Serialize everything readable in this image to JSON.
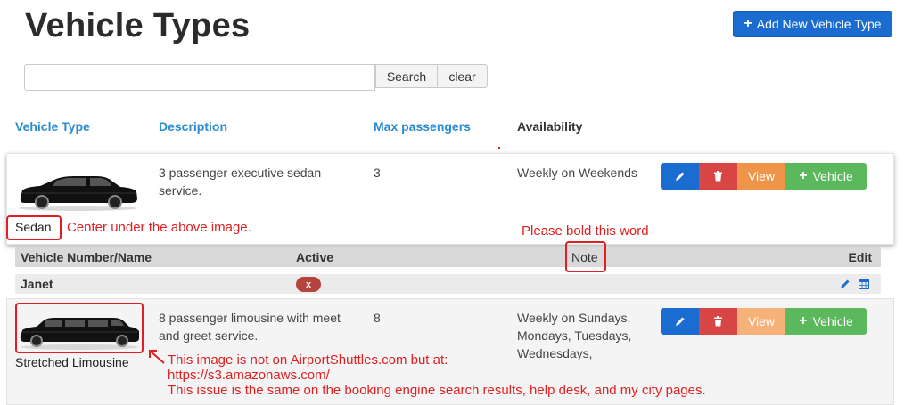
{
  "header": {
    "title": "Vehicle Types",
    "add_button_label": "Add New Vehicle Type"
  },
  "search": {
    "value": "",
    "placeholder": "",
    "search_label": "Search",
    "clear_label": "clear"
  },
  "table": {
    "columns": [
      "Vehicle Type",
      "Description",
      "Max passengers",
      "Availability"
    ]
  },
  "vehicle_types": [
    {
      "name": "Sedan",
      "description_lines": [
        "3 passenger executive sedan",
        "service."
      ],
      "max_passengers": "3",
      "availability_lines": [
        "Weekly on Weekends"
      ],
      "actions": {
        "view": "View",
        "vehicle": "Vehicle"
      }
    },
    {
      "name": "Stretched Limousine",
      "description_lines": [
        "8 passenger limousine with meet",
        "and greet service."
      ],
      "max_passengers": "8",
      "availability_lines": [
        "Weekly on Sundays,",
        "Mondays, Tuesdays,",
        "Wednesdays,"
      ],
      "actions": {
        "view": "View",
        "vehicle": "Vehicle"
      }
    }
  ],
  "vehicles_subtable": {
    "headers": {
      "name": "Vehicle Number/Name",
      "active": "Active",
      "note": "Note",
      "edit": "Edit"
    },
    "rows": [
      {
        "name": "Janet",
        "active": "x"
      }
    ]
  },
  "annotations": {
    "center_note": "Center under the above image.",
    "bold_note": "Please bold this word",
    "image_note_lines": [
      "This image is not on AirportShuttles.com but at:",
      "https://s3.amazonaws.com/",
      "This issue is the same on the booking engine search results, help desk, and my city pages."
    ]
  },
  "icons": {
    "edit": "pencil-icon",
    "delete": "trash-icon",
    "add": "plus-icon",
    "calendar": "calendar-icon"
  },
  "colors": {
    "primary": "#1a6cd0",
    "danger": "#d84545",
    "warning": "#f0944a",
    "success": "#5cb85c",
    "header_link": "#2a8bd1",
    "annotation": "#e02020"
  }
}
